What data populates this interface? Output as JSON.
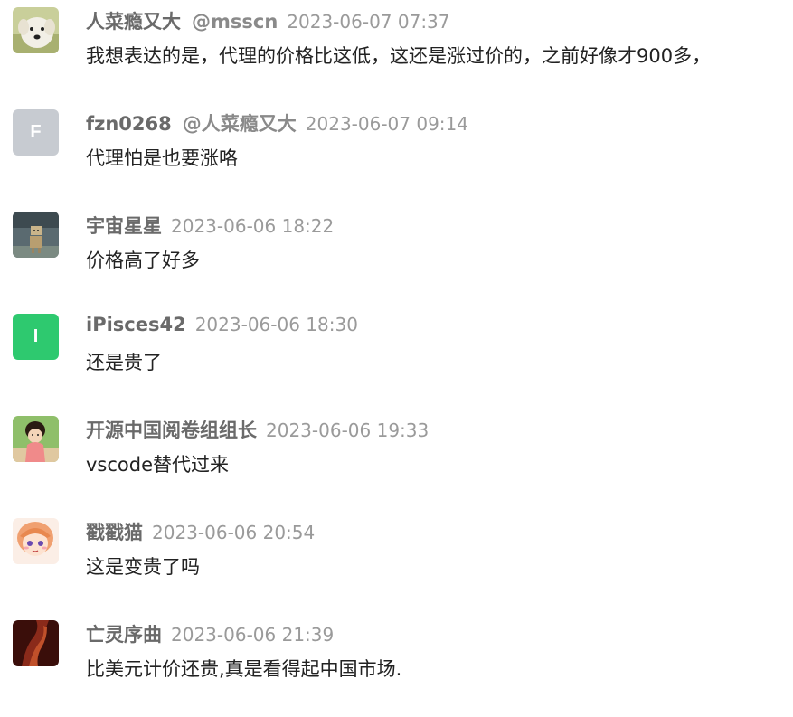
{
  "comments": [
    {
      "username": "人菜瘾又大",
      "mention": "@msscn",
      "time": "2023-06-07 07:37",
      "content": "我想表达的是，代理的价格比这低，这还是涨过价的，之前好像才900多，",
      "avatar": {
        "type": "image",
        "icon": "dog-photo-avatar",
        "color": "#c9cf9a"
      }
    },
    {
      "username": "fzn0268",
      "mention": "@人菜瘾又大",
      "time": "2023-06-07 09:14",
      "content": "代理怕是也要涨咯",
      "avatar": {
        "type": "letter",
        "letter": "F",
        "color": "#c7cbd1"
      }
    },
    {
      "username": "宇宙星星",
      "mention": "",
      "time": "2023-06-06 18:22",
      "content": "价格高了好多",
      "avatar": {
        "type": "image",
        "icon": "robot-figure-avatar",
        "color": "#5a6a70"
      }
    },
    {
      "username": "iPisces42",
      "mention": "",
      "time": "2023-06-06 18:30",
      "content": "还是贵了",
      "avatar": {
        "type": "letter",
        "letter": "I",
        "color": "#2ec96f"
      }
    },
    {
      "username": "开源中国阅卷组组长",
      "mention": "",
      "time": "2023-06-06 19:33",
      "content": "vscode替代过来",
      "avatar": {
        "type": "image",
        "icon": "child-photo-avatar",
        "color": "#8fbf6a"
      }
    },
    {
      "username": "戳戳猫",
      "mention": "",
      "time": "2023-06-06 20:54",
      "content": "这是变贵了吗",
      "avatar": {
        "type": "image",
        "icon": "anime-girl-avatar",
        "color": "#f2c6a8"
      }
    },
    {
      "username": "亡灵序曲",
      "mention": "",
      "time": "2023-06-06 21:39",
      "content": "比美元计价还贵,真是看得起中国市场.",
      "avatar": {
        "type": "image",
        "icon": "dark-red-abstract-avatar",
        "color": "#5a1a14"
      }
    }
  ]
}
